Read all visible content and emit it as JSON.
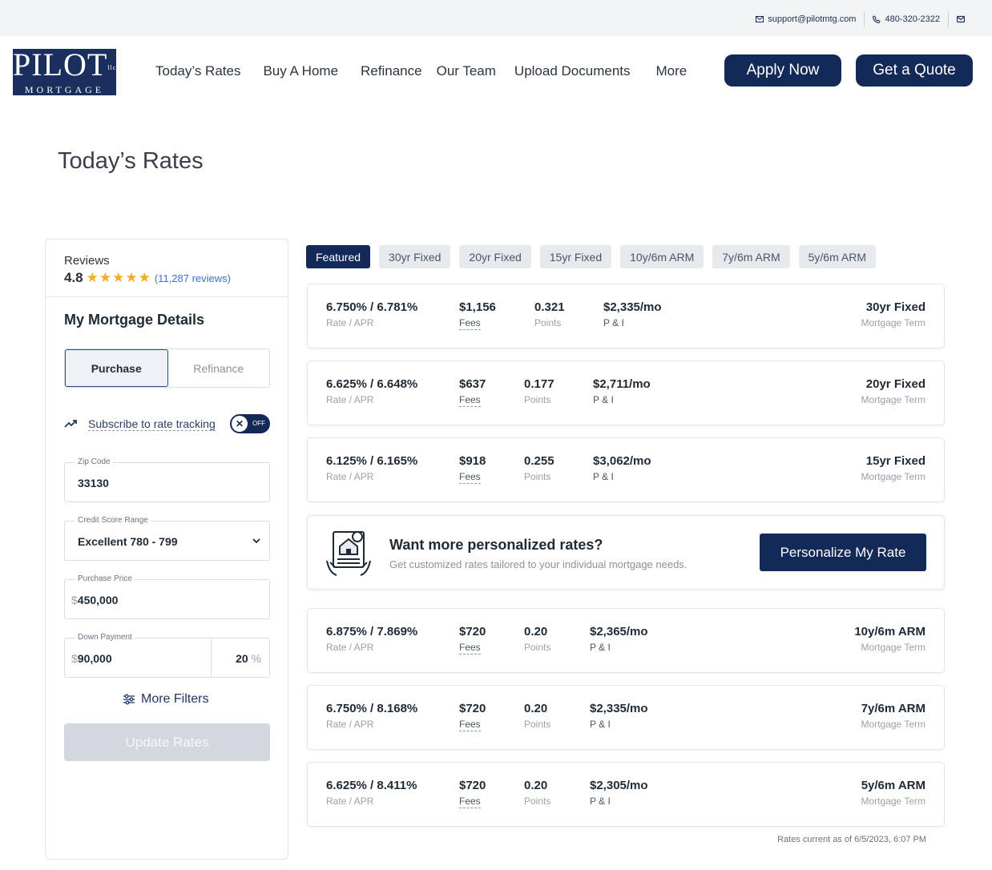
{
  "topbar": {
    "email": "support@pilotmtg.com",
    "phone": "480-320-2322"
  },
  "logo": {
    "line1": "PILOT",
    "llc": "llc",
    "line2": "MORTGAGE"
  },
  "nav": {
    "items": [
      "Today’s Rates",
      "Buy A Home",
      "Refinance",
      "Our Team",
      "Upload Documents",
      "More"
    ],
    "apply_label": "Apply Now",
    "quote_label": "Get a Quote"
  },
  "page_title": "Today’s Rates",
  "sidebar": {
    "reviews_label": "Reviews",
    "rating": "4.8",
    "stars": "★★★★★",
    "review_count": "(11,287 reviews)",
    "details_title": "My Mortgage Details",
    "loan_types": [
      "Purchase",
      "Refinance"
    ],
    "selected_loan_type": "Purchase",
    "subscribe_label": "Subscribe to rate tracking",
    "subscribe_state": "OFF",
    "zip": {
      "label": "Zip Code",
      "value": "33130"
    },
    "credit": {
      "label": "Credit Score Range",
      "value": "Excellent 780 - 799"
    },
    "price": {
      "label": "Purchase Price",
      "prefix": "$",
      "value": "450,000"
    },
    "down": {
      "label": "Down Payment",
      "prefix": "$",
      "value": "90,000",
      "percent": "20",
      "pct_sign": "%"
    },
    "more_filters_label": "More Filters",
    "update_label": "Update Rates"
  },
  "tabs": [
    "Featured",
    "30yr Fixed",
    "20yr Fixed",
    "15yr Fixed",
    "10y/6m ARM",
    "7y/6m ARM",
    "5y/6m ARM"
  ],
  "active_tab": "Featured",
  "labels": {
    "rate_apr": "Rate / APR",
    "fees": "Fees",
    "points": "Points",
    "pi": "P & I",
    "term": "Mortgage Term"
  },
  "rates": [
    {
      "rate": "6.750% / 6.781%",
      "fees": "$1,156",
      "points": "0.321",
      "pi": "$2,335/mo",
      "term": "30yr Fixed"
    },
    {
      "rate": "6.625% / 6.648%",
      "fees": "$637",
      "points": "0.177",
      "pi": "$2,711/mo",
      "term": "20yr Fixed"
    },
    {
      "rate": "6.125% / 6.165%",
      "fees": "$918",
      "points": "0.255",
      "pi": "$3,062/mo",
      "term": "15yr Fixed"
    },
    {
      "rate": "6.875% / 7.869%",
      "fees": "$720",
      "points": "0.20",
      "pi": "$2,365/mo",
      "term": "10y/6m ARM"
    },
    {
      "rate": "6.750% / 8.168%",
      "fees": "$720",
      "points": "0.20",
      "pi": "$2,335/mo",
      "term": "7y/6m ARM"
    },
    {
      "rate": "6.625% / 8.411%",
      "fees": "$720",
      "points": "0.20",
      "pi": "$2,305/mo",
      "term": "5y/6m ARM"
    }
  ],
  "promo": {
    "title": "Want more personalized rates?",
    "subtitle": "Get customized rates tailored to your individual mortgage needs.",
    "button_label": "Personalize My Rate"
  },
  "rates_current": "Rates current as of 6/5/2023, 6:07 PM",
  "colors": {
    "brand_navy": "#132a58",
    "star": "#f2b01e",
    "link_blue": "#3c6fd6"
  }
}
